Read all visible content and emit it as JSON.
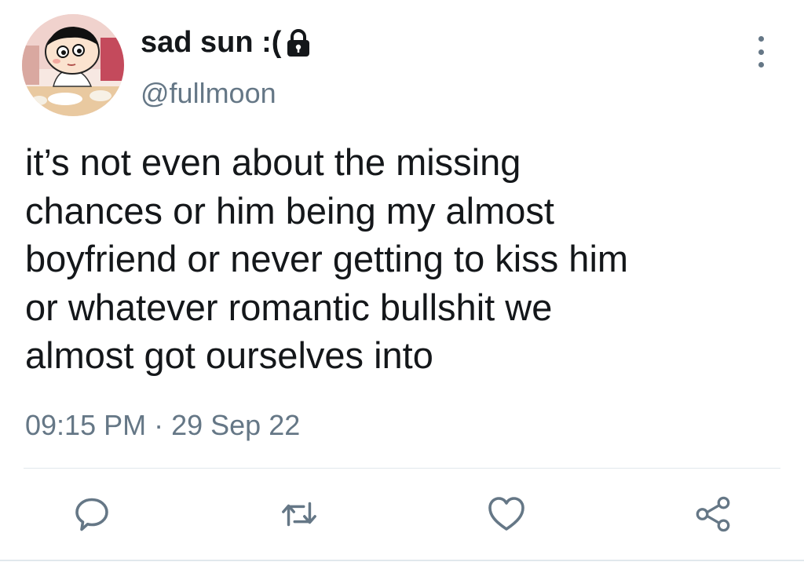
{
  "user": {
    "display_name": "sad sun :(",
    "handle": "@fullmoon",
    "avatar_icon": "cartoon-avatar",
    "protected_icon": "lock-icon"
  },
  "tweet": {
    "text": "it’s not even about the missing\nchances or him being my almost\nboyfriend or never getting to kiss him\nor whatever romantic bullshit we\nalmost got ourselves into",
    "time": "09:15 PM",
    "separator": "·",
    "date": "29 Sep 22"
  },
  "actions": [
    {
      "icon": "reply-icon"
    },
    {
      "icon": "retweet-icon"
    },
    {
      "icon": "like-icon"
    },
    {
      "icon": "share-icon"
    }
  ],
  "menu_icon": "more-options-icon",
  "colors": {
    "text": "#14171a",
    "secondary": "#657786",
    "divider": "#e1e8ed"
  }
}
